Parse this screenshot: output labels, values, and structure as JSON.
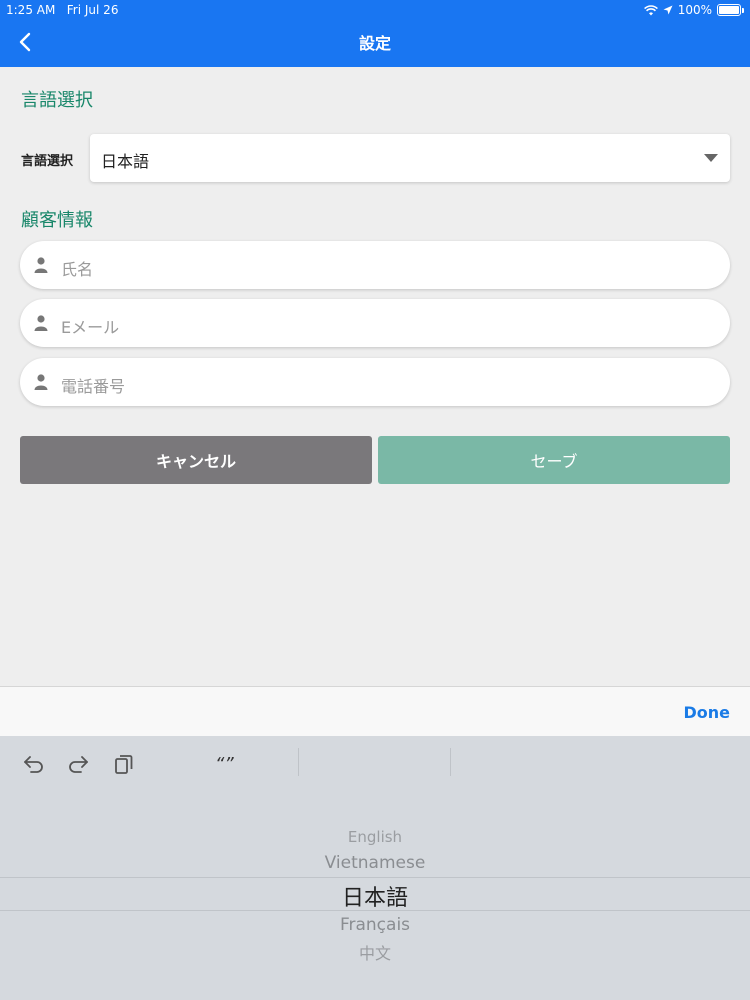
{
  "status": {
    "time": "1:25 AM",
    "date": "Fri Jul 26",
    "battery": "100%"
  },
  "nav": {
    "title": "設定",
    "back_icon": "chevron-left-icon"
  },
  "language_section": {
    "title": "言語選択",
    "label": "言語選択",
    "selected": "日本語"
  },
  "customer_section": {
    "title": "顧客情報",
    "fields": [
      {
        "placeholder": "氏名",
        "icon": "person-icon"
      },
      {
        "placeholder": "Eメール",
        "icon": "person-icon"
      },
      {
        "placeholder": "電話番号",
        "icon": "person-icon"
      }
    ]
  },
  "buttons": {
    "cancel": "キャンセル",
    "save": "セーブ"
  },
  "accessory": {
    "done": "Done"
  },
  "keyboard": {
    "quote": "“”"
  },
  "picker": {
    "options": [
      "English",
      "Vietnamese",
      "日本語",
      "Français",
      "中文"
    ],
    "selected_index": 2
  },
  "colors": {
    "nav_bar": "#1976f2",
    "section_title": "#19876a",
    "cancel_button": "#7a787b",
    "save_button": "#7ab8a6",
    "done_link": "#1a7be6"
  }
}
